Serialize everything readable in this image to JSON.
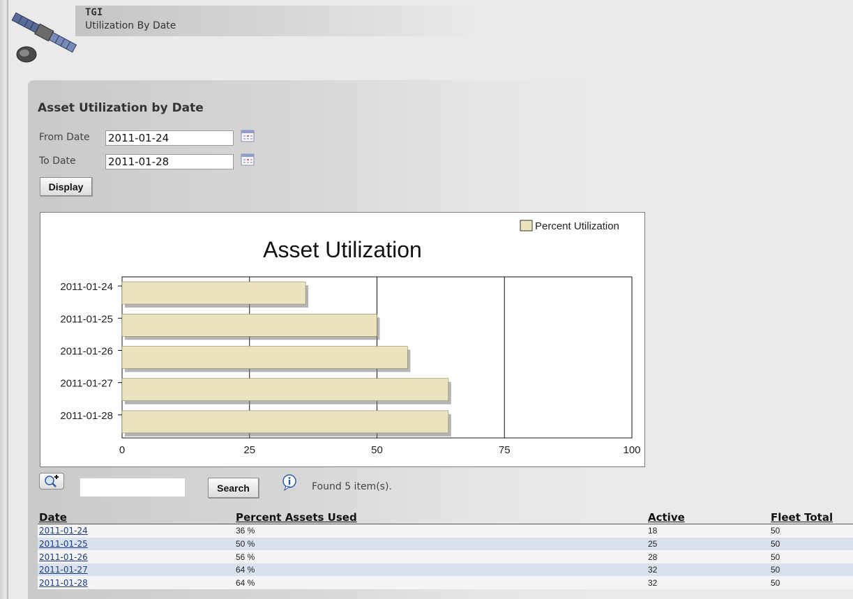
{
  "header": {
    "app_name": "TGI",
    "subtitle": "Utilization By Date",
    "logo_icon": "satellite-icon"
  },
  "panel": {
    "title": "Asset Utilization by Date"
  },
  "form": {
    "from_label": "From Date",
    "from_value": "2011-01-24",
    "to_label": "To Date",
    "to_value": "2011-01-28",
    "calendar_icon": "calendar-icon",
    "display_label": "Display"
  },
  "colors": {
    "bar_fill": "#ebe4bf",
    "bar_edge": "#8c8560",
    "row_alt": "#d9e2ec",
    "link": "#1a3d8a"
  },
  "chart_data": {
    "type": "bar",
    "orientation": "horizontal",
    "title": "Asset Utilization",
    "legend": "Percent Utilization",
    "legend_position": "top-right",
    "categories": [
      "2011-01-24",
      "2011-01-25",
      "2011-01-26",
      "2011-01-27",
      "2011-01-28"
    ],
    "series": [
      {
        "name": "Percent Utilization",
        "values": [
          36,
          50,
          56,
          64,
          64
        ]
      }
    ],
    "xlim": [
      0,
      100
    ],
    "xticks": [
      "0",
      "25",
      "50",
      "75",
      "100"
    ],
    "grid": "vertical"
  },
  "search": {
    "zoom_icon": "zoom-in-icon",
    "button_label": "Search",
    "info_icon": "info-icon",
    "found_text": "Found 5 item(s)."
  },
  "table": {
    "columns": [
      "Date",
      "Percent Assets Used",
      "Active",
      "Fleet Total"
    ],
    "rows": [
      [
        "2011-01-24",
        "36 %",
        "18",
        "50"
      ],
      [
        "2011-01-25",
        "50 %",
        "25",
        "50"
      ],
      [
        "2011-01-26",
        "56 %",
        "28",
        "50"
      ],
      [
        "2011-01-27",
        "64 %",
        "32",
        "50"
      ],
      [
        "2011-01-28",
        "64 %",
        "32",
        "50"
      ]
    ]
  }
}
